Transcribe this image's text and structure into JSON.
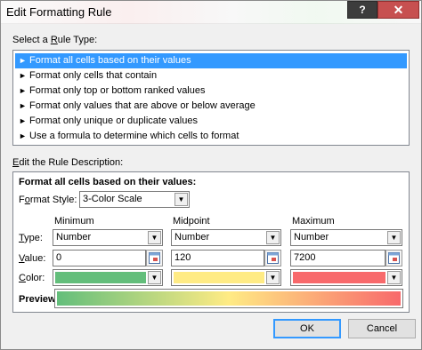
{
  "window": {
    "title": "Edit Formatting Rule",
    "help_label": "?",
    "close_label": "✕"
  },
  "rule_type": {
    "heading_prefix": "Select a ",
    "heading_hotkey": "R",
    "heading_suffix": "ule Type:",
    "items": [
      {
        "label": "Format all cells based on their values",
        "selected": true
      },
      {
        "label": "Format only cells that contain",
        "selected": false
      },
      {
        "label": "Format only top or bottom ranked values",
        "selected": false
      },
      {
        "label": "Format only values that are above or below average",
        "selected": false
      },
      {
        "label": "Format only unique or duplicate values",
        "selected": false
      },
      {
        "label": "Use a formula to determine which cells to format",
        "selected": false
      }
    ],
    "arrow_glyph": "►"
  },
  "description": {
    "heading_prefix": "",
    "heading_hotkey": "E",
    "heading_suffix": "dit the Rule Description:",
    "bold_title": "Format all cells based on their values:",
    "format_style_prefix": "F",
    "format_style_hotkey": "o",
    "format_style_suffix": "rmat Style:",
    "format_style_value": "3-Color Scale",
    "row_labels": {
      "type_prefix": "",
      "type_hotkey": "T",
      "type_suffix": "ype:",
      "value_prefix": "",
      "value_hotkey": "V",
      "value_suffix": "alue:",
      "color_prefix": "",
      "color_hotkey": "C",
      "color_suffix": "olor:"
    },
    "columns": [
      {
        "header": "Minimum",
        "type": "Number",
        "value": "0",
        "color": "#63be7b"
      },
      {
        "header": "Midpoint",
        "type": "Number",
        "value": "120",
        "color": "#ffeb84"
      },
      {
        "header": "Maximum",
        "type": "Number",
        "value": "7200",
        "color": "#f8696b"
      }
    ],
    "preview_label": "Preview:"
  },
  "buttons": {
    "ok": "OK",
    "cancel": "Cancel"
  }
}
